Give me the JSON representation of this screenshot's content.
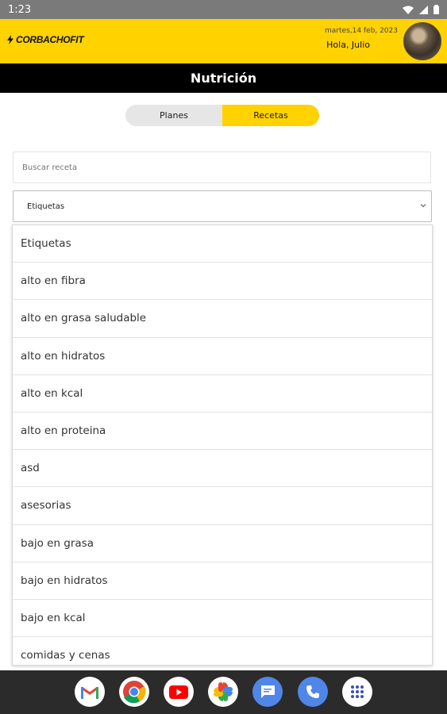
{
  "status_bar": {
    "time": "1:23"
  },
  "header": {
    "logo_text": "CORBACHOFIT",
    "date": "martes,14 feb, 2023",
    "greeting": "Hola, Julio"
  },
  "page_title": "Nutrición",
  "tabs": [
    {
      "label": "Planes",
      "active": false
    },
    {
      "label": "Recetas",
      "active": true
    }
  ],
  "search": {
    "placeholder": "Buscar receta",
    "value": ""
  },
  "tag_select": {
    "selected": "Etiquetas"
  },
  "tag_options": [
    "Etiquetas",
    "alto en fibra",
    "alto en grasa saludable",
    "alto en hidratos",
    "alto en kcal",
    "alto en proteina",
    "asd",
    "asesorias",
    "bajo en grasa",
    "bajo en hidratos",
    "bajo en kcal",
    "comidas y cenas"
  ],
  "colors": {
    "accent": "#ffd200",
    "title_bar": "#000000",
    "nav_bar": "#2b2b2b",
    "status_bar": "#7a7a7a"
  },
  "nav_apps": [
    "gmail-icon",
    "chrome-icon",
    "youtube-icon",
    "photos-icon",
    "messages-icon",
    "phone-icon",
    "apps-icon"
  ]
}
